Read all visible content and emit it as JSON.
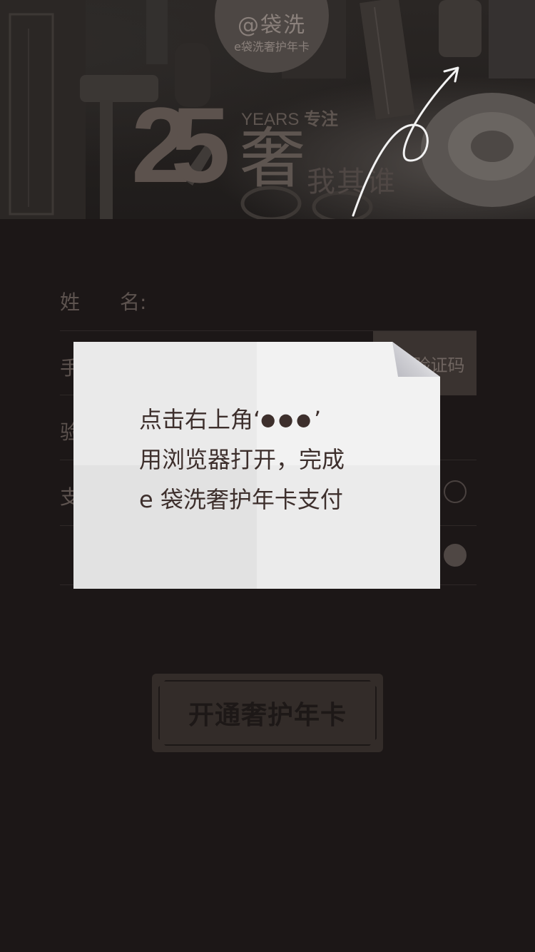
{
  "hero": {
    "logo_main": "@袋洗",
    "logo_sub": "e袋洗奢护年卡",
    "big_number": "25",
    "years_text": "YEARS",
    "years_strong": "专注",
    "she_char": "奢",
    "slogan_tail": "我其谁"
  },
  "form": {
    "name_label": "姓　　名:",
    "phone_label_partial": "手",
    "sms_button_partial": "验证码",
    "code_label_partial": "验",
    "pay_label_partial": "支"
  },
  "popup": {
    "line1_prefix": "点击右上角‘",
    "line1_dots": "●●●",
    "line1_suffix": "’",
    "line2": "用浏览器打开，完成",
    "line3": "e 袋洗奢护年卡支付"
  },
  "cta": {
    "label": "开通奢护年卡"
  },
  "colors": {
    "background": "#1c1717",
    "popup_text": "#3d2f2c",
    "button_bg": "#332c29"
  },
  "radio_state": {
    "option1_selected": false,
    "option2_selected": true
  }
}
